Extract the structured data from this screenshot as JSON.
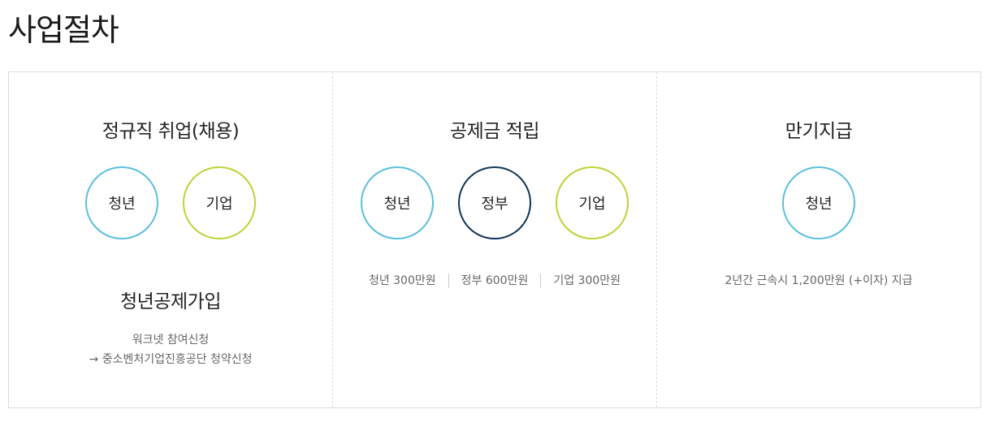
{
  "page": {
    "title": "사업절차"
  },
  "steps": [
    {
      "title": "정규직 취업(채용)",
      "circles": [
        "청년",
        "기업"
      ],
      "sub_title": "청년공제가입",
      "notes": [
        "워크넷 참여신청",
        "→ 중소벤처기업진흥공단 청약신청"
      ]
    },
    {
      "title": "공제금 적립",
      "circles": [
        "청년",
        "정부",
        "기업"
      ],
      "amounts": [
        "청년 300만원",
        "정부 600만원",
        "기업 300만원"
      ]
    },
    {
      "title": "만기지급",
      "circles": [
        "청년"
      ],
      "payout": "2년간 근속시 1,200만원 (+이자) 지급"
    }
  ],
  "colors": {
    "youth": "#5bbfde",
    "company": "#bcd437",
    "government": "#0f3557",
    "border": "#dcdcdc"
  }
}
